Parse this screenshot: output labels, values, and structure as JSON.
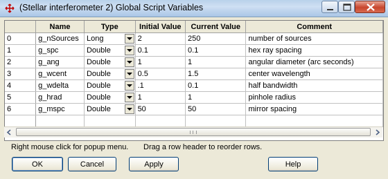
{
  "window": {
    "title": "(Stellar interferometer 2) Global Script Variables"
  },
  "table": {
    "columns": [
      "",
      "Name",
      "Type",
      "Initial Value",
      "Current Value",
      "Comment"
    ],
    "rows": [
      {
        "index": "0",
        "name": "g_nSources",
        "type": "Long",
        "initial": "2",
        "current": "250",
        "comment": "number of sources"
      },
      {
        "index": "1",
        "name": "g_spc",
        "type": "Double",
        "initial": "0.1",
        "current": "0.1",
        "comment": "hex ray spacing"
      },
      {
        "index": "2",
        "name": "g_ang",
        "type": "Double",
        "initial": "1",
        "current": "1",
        "comment": "angular diameter (arc seconds)"
      },
      {
        "index": "3",
        "name": "g_wcent",
        "type": "Double",
        "initial": "0.5",
        "current": "1.5",
        "comment": "center wavelength"
      },
      {
        "index": "4",
        "name": "g_wdelta",
        "type": "Double",
        "initial": ".1",
        "current": "0.1",
        "comment": "half bandwidth"
      },
      {
        "index": "5",
        "name": "g_hrad",
        "type": "Double",
        "initial": "1",
        "current": "1",
        "comment": "pinhole radius"
      },
      {
        "index": "6",
        "name": "g_mspc",
        "type": "Double",
        "initial": "50",
        "current": "50",
        "comment": "mirror spacing"
      }
    ]
  },
  "status": {
    "left": "Right mouse click for popup menu.",
    "right": "Drag a row header to reorder rows."
  },
  "buttons": {
    "ok": "OK",
    "cancel": "Cancel",
    "apply": "Apply",
    "help": "Help"
  }
}
